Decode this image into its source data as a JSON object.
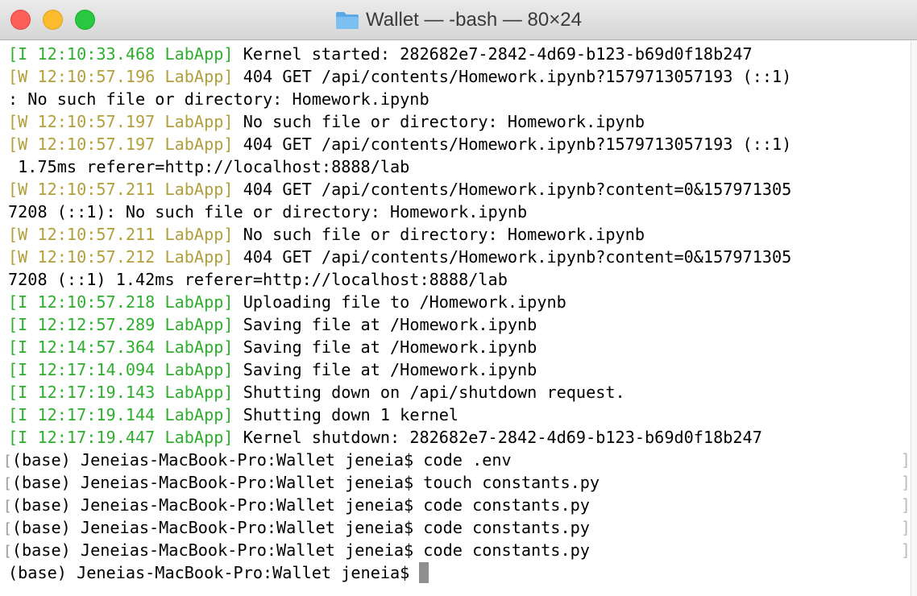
{
  "window": {
    "title": "Wallet — -bash — 80×24"
  },
  "terminal": {
    "lines": [
      {
        "prefix": "[I 12:10:33.468 LabApp]",
        "level": "I",
        "text": " Kernel started: 282682e7-2842-4d69-b123-b69d0f18b247"
      },
      {
        "prefix": "[W 12:10:57.196 LabApp]",
        "level": "W",
        "text": " 404 GET /api/contents/Homework.ipynb?1579713057193 (::1)"
      },
      {
        "prefix": "",
        "level": "",
        "text": ": No such file or directory: Homework.ipynb"
      },
      {
        "prefix": "[W 12:10:57.197 LabApp]",
        "level": "W",
        "text": " No such file or directory: Homework.ipynb"
      },
      {
        "prefix": "[W 12:10:57.197 LabApp]",
        "level": "W",
        "text": " 404 GET /api/contents/Homework.ipynb?1579713057193 (::1)"
      },
      {
        "prefix": "",
        "level": "",
        "text": " 1.75ms referer=http://localhost:8888/lab"
      },
      {
        "prefix": "[W 12:10:57.211 LabApp]",
        "level": "W",
        "text": " 404 GET /api/contents/Homework.ipynb?content=0&157971305"
      },
      {
        "prefix": "",
        "level": "",
        "text": "7208 (::1): No such file or directory: Homework.ipynb"
      },
      {
        "prefix": "[W 12:10:57.211 LabApp]",
        "level": "W",
        "text": " No such file or directory: Homework.ipynb"
      },
      {
        "prefix": "[W 12:10:57.212 LabApp]",
        "level": "W",
        "text": " 404 GET /api/contents/Homework.ipynb?content=0&157971305"
      },
      {
        "prefix": "",
        "level": "",
        "text": "7208 (::1) 1.42ms referer=http://localhost:8888/lab"
      },
      {
        "prefix": "[I 12:10:57.218 LabApp]",
        "level": "I",
        "text": " Uploading file to /Homework.ipynb"
      },
      {
        "prefix": "[I 12:12:57.289 LabApp]",
        "level": "I",
        "text": " Saving file at /Homework.ipynb"
      },
      {
        "prefix": "[I 12:14:57.364 LabApp]",
        "level": "I",
        "text": " Saving file at /Homework.ipynb"
      },
      {
        "prefix": "[I 12:17:14.094 LabApp]",
        "level": "I",
        "text": " Saving file at /Homework.ipynb"
      },
      {
        "prefix": "[I 12:17:19.143 LabApp]",
        "level": "I",
        "text": " Shutting down on /api/shutdown request."
      },
      {
        "prefix": "[I 12:17:19.144 LabApp]",
        "level": "I",
        "text": " Shutting down 1 kernel"
      },
      {
        "prefix": "[I 12:17:19.447 LabApp]",
        "level": "I",
        "text": " Kernel shutdown: 282682e7-2842-4d69-b123-b69d0f18b247"
      }
    ],
    "prompts": [
      {
        "text": "(base) Jeneias-MacBook-Pro:Wallet jeneia$ code .env",
        "marked": true
      },
      {
        "text": "(base) Jeneias-MacBook-Pro:Wallet jeneia$ touch constants.py",
        "marked": true
      },
      {
        "text": "(base) Jeneias-MacBook-Pro:Wallet jeneia$ code constants.py",
        "marked": true
      },
      {
        "text": "(base) Jeneias-MacBook-Pro:Wallet jeneia$ code constants.py",
        "marked": true
      },
      {
        "text": "(base) Jeneias-MacBook-Pro:Wallet jeneia$ code constants.py",
        "marked": true
      }
    ],
    "current_prompt": "(base) Jeneias-MacBook-Pro:Wallet jeneia$ "
  },
  "colors": {
    "info_prefix": "#2eaf2e",
    "warn_prefix": "#b1a03c",
    "text": "#000000",
    "cursor": "#8f8f8f"
  }
}
